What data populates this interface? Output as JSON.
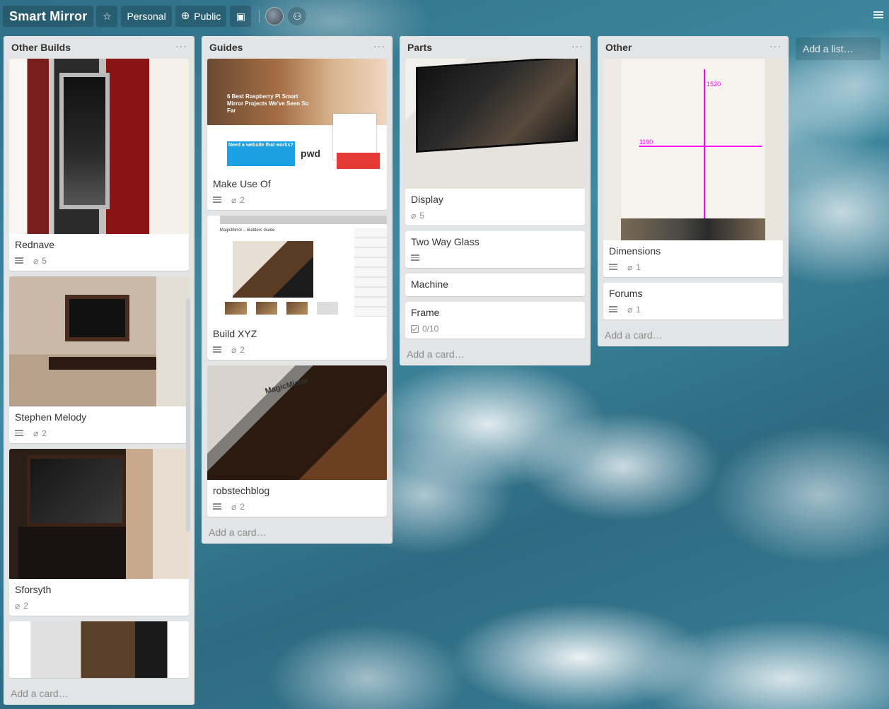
{
  "header": {
    "board_title": "Smart Mirror",
    "personal_label": "Personal",
    "visibility_label": "Public"
  },
  "lists": [
    {
      "title": "Other Builds",
      "add_card": "Add a card…",
      "cards": [
        {
          "title": "Rednave",
          "attachments": "5"
        },
        {
          "title": "Stephen Melody",
          "attachments": "2"
        },
        {
          "title": "Sforsyth",
          "attachments": "2"
        }
      ]
    },
    {
      "title": "Guides",
      "add_card": "Add a card…",
      "cards": [
        {
          "title": "Make Use Of",
          "attachments": "2"
        },
        {
          "title": "Build XYZ",
          "attachments": "2"
        },
        {
          "title": "robstechblog",
          "attachments": "2"
        }
      ]
    },
    {
      "title": "Parts",
      "add_card": "Add a card…",
      "cards": [
        {
          "title": "Display",
          "attachments": "5"
        },
        {
          "title": "Two Way Glass"
        },
        {
          "title": "Machine"
        },
        {
          "title": "Frame",
          "checklist": "0/10"
        }
      ]
    },
    {
      "title": "Other",
      "add_card": "Add a card…",
      "cards": [
        {
          "title": "Dimensions",
          "attachments": "1"
        },
        {
          "title": "Forums",
          "attachments": "1"
        }
      ]
    }
  ],
  "add_list": "Add a list…",
  "images": {
    "makeuseof_headline": "6 Best Raspberry Pi Smart Mirror Projects We've Seen So Far",
    "makeuseof_ad": "Need a website that works?",
    "makeuseof_logo": "pwd",
    "buildxyz_header": "MagicMirror – Builders Guide",
    "robs_label": "MagicMirror",
    "dimension_vertical": "1520",
    "dimension_horizontal": "1190"
  },
  "icons": {
    "star": "star-icon",
    "public": "globe-icon",
    "power_up": "power-up-icon",
    "add_member": "add-member-icon",
    "menu": "menu-icon"
  }
}
